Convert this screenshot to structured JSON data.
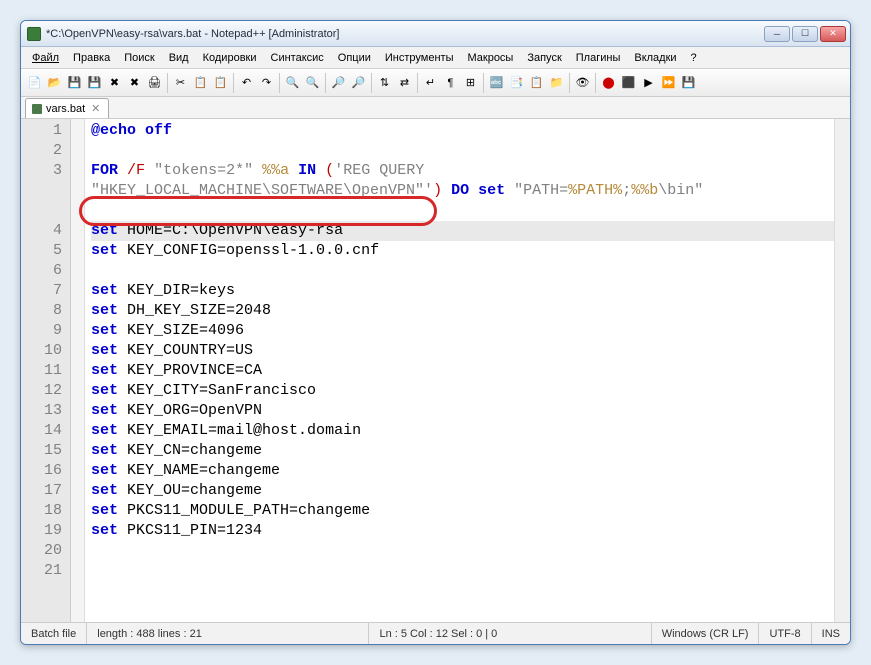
{
  "title": "*C:\\OpenVPN\\easy-rsa\\vars.bat - Notepad++ [Administrator]",
  "menus": {
    "file": "Файл",
    "edit": "Правка",
    "search": "Поиск",
    "view": "Вид",
    "encoding": "Кодировки",
    "syntax": "Синтаксис",
    "options": "Опции",
    "tools": "Инструменты",
    "macro": "Макросы",
    "run": "Запуск",
    "plugins": "Плагины",
    "tabs": "Вкладки",
    "help": "?"
  },
  "tab": {
    "label": "vars.bat"
  },
  "code": {
    "l1": "@echo off",
    "l3a": "FOR",
    "l3b": "/F",
    "l3c": "\"tokens=2*\"",
    "l3d": "%%a",
    "l3e": "IN",
    "l3f": "(",
    "l3g": "'REG QUERY",
    "l3h": "\"HKEY_LOCAL_MACHINE\\SOFTWARE\\OpenVPN\"'",
    "l3i": ")",
    "l3j": "DO",
    "l3k": "set",
    "l3l": "\"PATH=",
    "l3m": "%PATH%",
    "l3n": ";",
    "l3o": "%%b",
    "l3p": "\\bin\"",
    "l5a": "set",
    "l5b": "HOME=C:\\OpenVPN\\easy-rsa",
    "l6a": "set",
    "l6b": "KEY_CONFIG=openssl-1.0.0.cnf",
    "l8a": "set",
    "l8b": "KEY_DIR=keys",
    "l9a": "set",
    "l9b": "DH_KEY_SIZE=2048",
    "l10a": "set",
    "l10b": "KEY_SIZE=4096",
    "l11a": "set",
    "l11b": "KEY_COUNTRY=US",
    "l12a": "set",
    "l12b": "KEY_PROVINCE=CA",
    "l13a": "set",
    "l13b": "KEY_CITY=SanFrancisco",
    "l14a": "set",
    "l14b": "KEY_ORG=OpenVPN",
    "l15a": "set",
    "l15b": "KEY_EMAIL=mail@host.domain",
    "l16a": "set",
    "l16b": "KEY_CN=changeme",
    "l17a": "set",
    "l17b": "KEY_NAME=changeme",
    "l18a": "set",
    "l18b": "KEY_OU=changeme",
    "l19a": "set",
    "l19b": "PKCS11_MODULE_PATH=changeme",
    "l20a": "set",
    "l20b": "PKCS11_PIN=1234"
  },
  "status": {
    "lang": "Batch file",
    "length": "length : 488    lines : 21",
    "pos": "Ln : 5    Col : 12    Sel : 0 | 0",
    "eol": "Windows (CR LF)",
    "enc": "UTF-8",
    "mode": "INS"
  }
}
